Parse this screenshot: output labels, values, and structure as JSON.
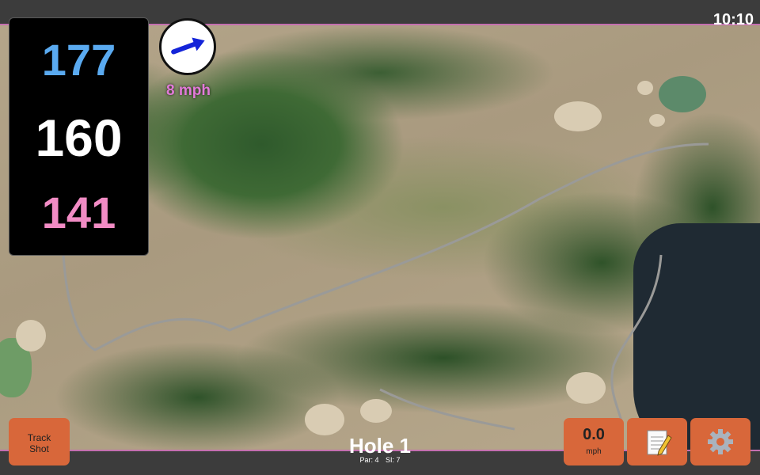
{
  "status": {
    "time": "10:10"
  },
  "distances": {
    "back": "177",
    "center": "160",
    "front": "141",
    "colors": {
      "back": "#5aaaf0",
      "center": "#ffffff",
      "front": "#f28cc5"
    }
  },
  "wind": {
    "speed_label": "8 mph",
    "direction_icon": "wind-arrow-icon",
    "button_value": "0.0",
    "button_unit": "mph"
  },
  "buttons": {
    "track_shot": "Track\nShot",
    "notes_icon": "notepad-icon",
    "settings_icon": "gear-icon",
    "accent": "#d8673a"
  },
  "hole": {
    "title": "Hole 1",
    "par": "Par: 4",
    "si": "SI: 7"
  }
}
